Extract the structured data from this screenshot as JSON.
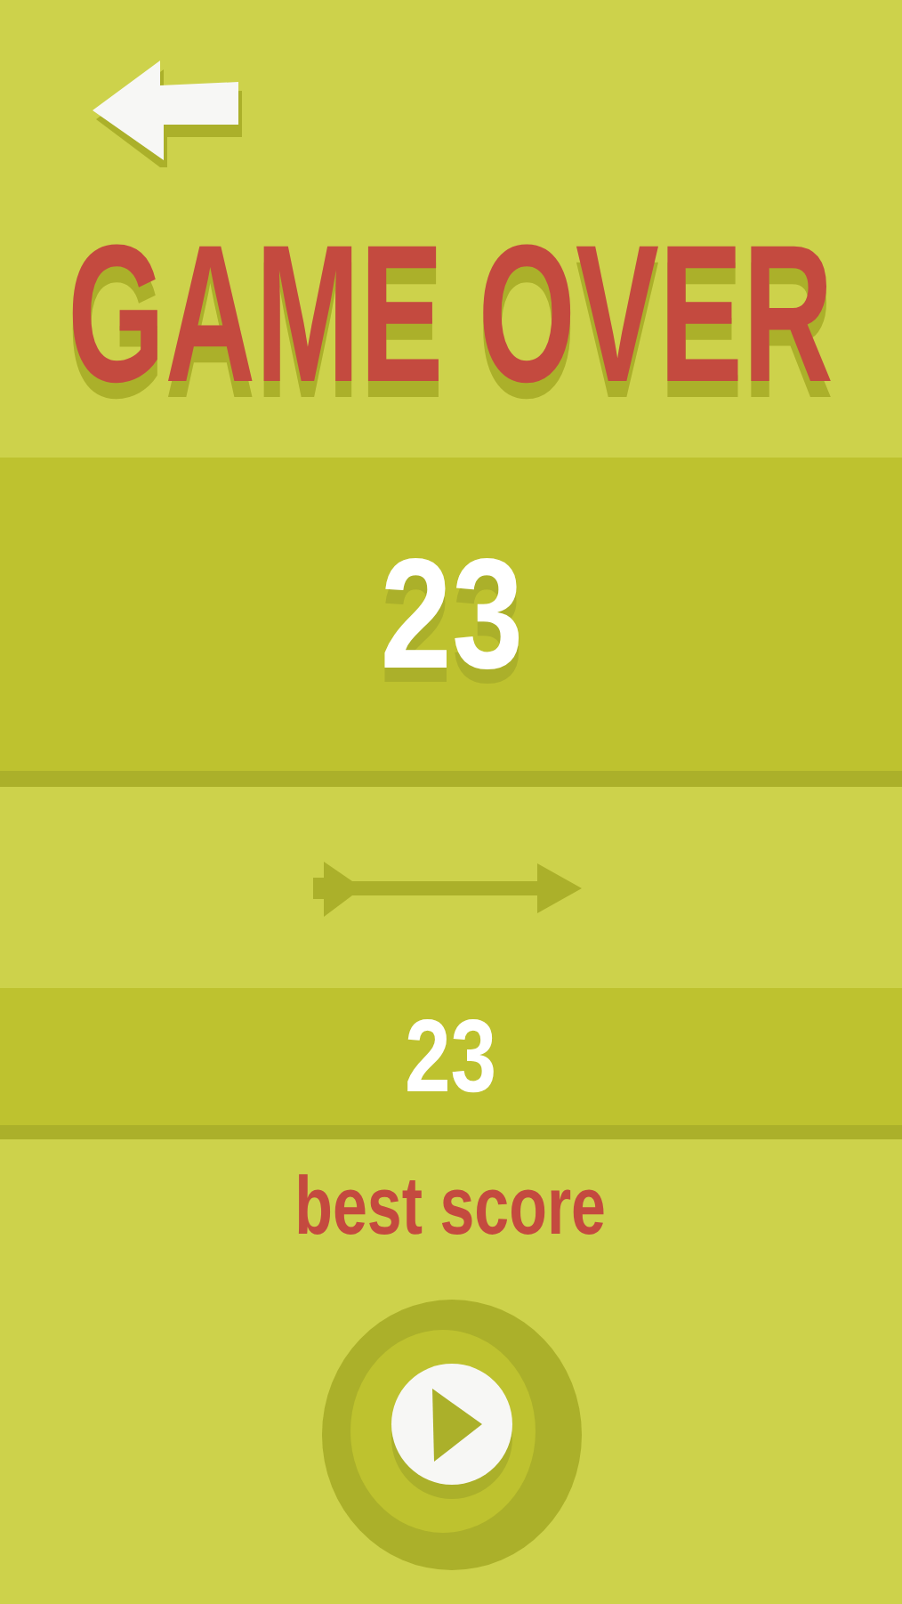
{
  "title": "GAME OVER",
  "score": "23",
  "best_score": {
    "value": "23",
    "label": "best score"
  }
}
